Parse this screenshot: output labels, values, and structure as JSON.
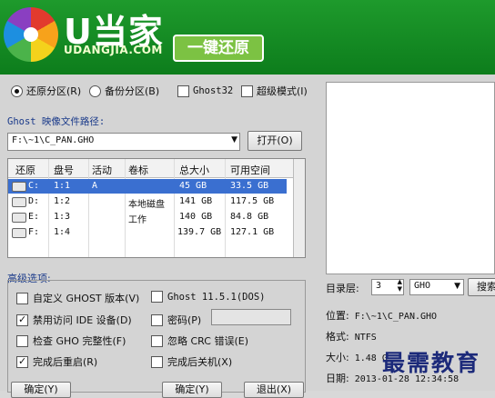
{
  "header": {
    "brand_cn": "U当家",
    "brand_en": "UDANGJIA.COM",
    "banner": "一键还原"
  },
  "modes": {
    "restore": "还原分区(R)",
    "backup": "备份分区(B)",
    "ghost32": "Ghost32",
    "super": "超级模式(I)"
  },
  "path": {
    "label": "Ghost 映像文件路径:",
    "value": "F:\\~1\\C_PAN.GHO",
    "open_button": "打开(O)"
  },
  "table": {
    "headers": [
      "还原",
      "盘号",
      "活动",
      "卷标",
      "总大小",
      "可用空间"
    ],
    "rows": [
      {
        "drive": "C:",
        "num": "1:1",
        "active": "A",
        "label": "",
        "total": "45 GB",
        "free": "33.5 GB"
      },
      {
        "drive": "D:",
        "num": "1:2",
        "active": "",
        "label": "本地磁盘",
        "total": "141 GB",
        "free": "117.5 GB"
      },
      {
        "drive": "E:",
        "num": "1:3",
        "active": "",
        "label": "工作",
        "total": "140 GB",
        "free": "84.8 GB"
      },
      {
        "drive": "F:",
        "num": "1:4",
        "active": "",
        "label": "",
        "total": "139.7 GB",
        "free": "127.1 GB"
      }
    ]
  },
  "advanced": {
    "title": "高级选项:",
    "custom_ghost": "自定义 GHOST 版本(V)",
    "ghost_ver": "Ghost 11.5.1(DOS)",
    "disable_ide": "禁用访问 IDE 设备(D)",
    "password": "密码(P)",
    "check_gho": "检查 GHO 完整性(F)",
    "ignore_crc": "忽略 CRC 错误(E)",
    "reboot": "完成后重启(R)",
    "shutdown": "完成后关机(X)"
  },
  "buttons": {
    "confirm": "确定(Y)",
    "restore_btn": "确定(Y)",
    "exit": "退出(X)"
  },
  "info": {
    "dir_level_label": "目录层:",
    "dir_level_value": "3",
    "ext_value": "GHO",
    "search_button": "搜索",
    "location_label": "位置:",
    "location_value": "F:\\~1\\C_PAN.GHO",
    "format_label": "格式:",
    "format_value": "NTFS",
    "size_label": "大小:",
    "size_value": "1.48 G",
    "date_label": "日期:",
    "date_value": "2013-01-28  12:34:58"
  },
  "watermark": "最需教育"
}
